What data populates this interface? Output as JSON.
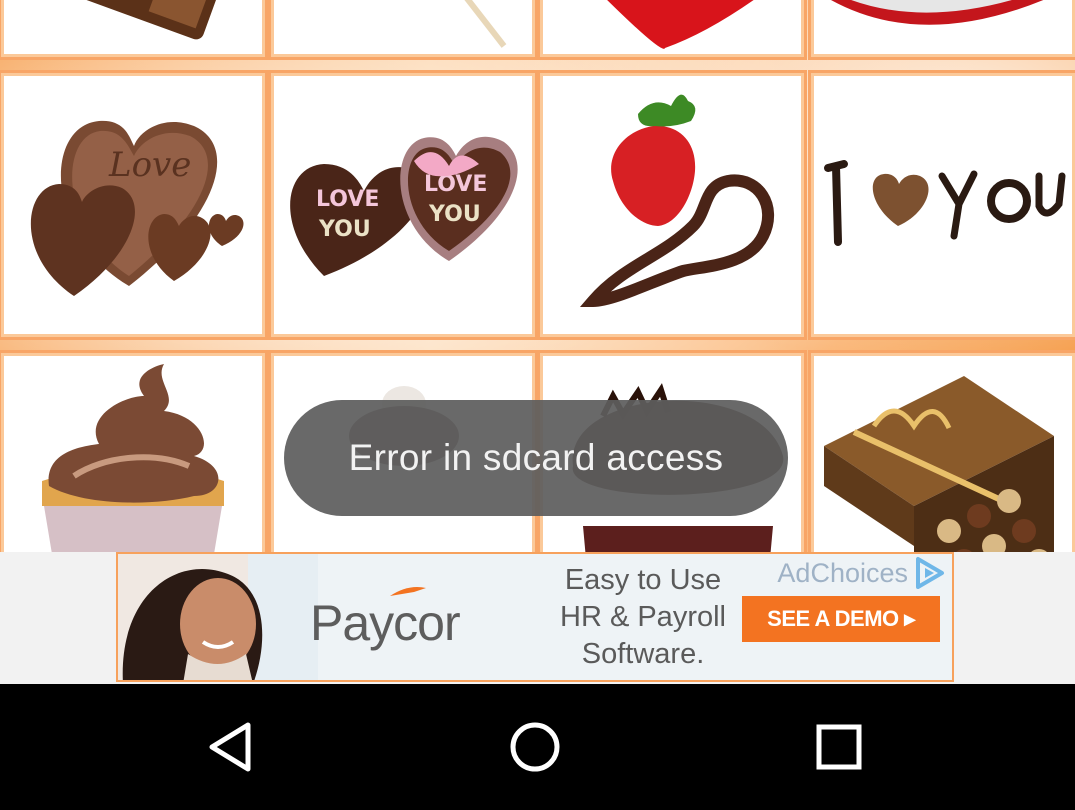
{
  "toast": {
    "message": "Error in sdcard access"
  },
  "gallery": {
    "tiles": [
      {
        "name": "chocolate-piece"
      },
      {
        "name": "lollipop"
      },
      {
        "name": "red-heart"
      },
      {
        "name": "heart-box"
      },
      {
        "name": "love-heart-chocolates"
      },
      {
        "name": "love-you-heart-chocolates"
      },
      {
        "name": "strawberry-chocolate-heart"
      },
      {
        "name": "i-love-you-chocolate"
      },
      {
        "name": "chocolate-cupcake"
      },
      {
        "name": "truffle"
      },
      {
        "name": "chocolate-muffin"
      },
      {
        "name": "chocolate-gift-box"
      }
    ]
  },
  "ad": {
    "brand": "Paycor",
    "tagline_lines": [
      "Easy to Use",
      "HR & Payroll",
      "Software."
    ],
    "adchoices_label": "AdChoices",
    "cta_label": "SEE A DEMO ▸",
    "colors": {
      "cta": "#f37321",
      "border": "#f7a15c",
      "adchoices": "#6fb7e8"
    }
  },
  "nav": {
    "back": "back-icon",
    "home": "home-icon",
    "recents": "recents-icon"
  }
}
